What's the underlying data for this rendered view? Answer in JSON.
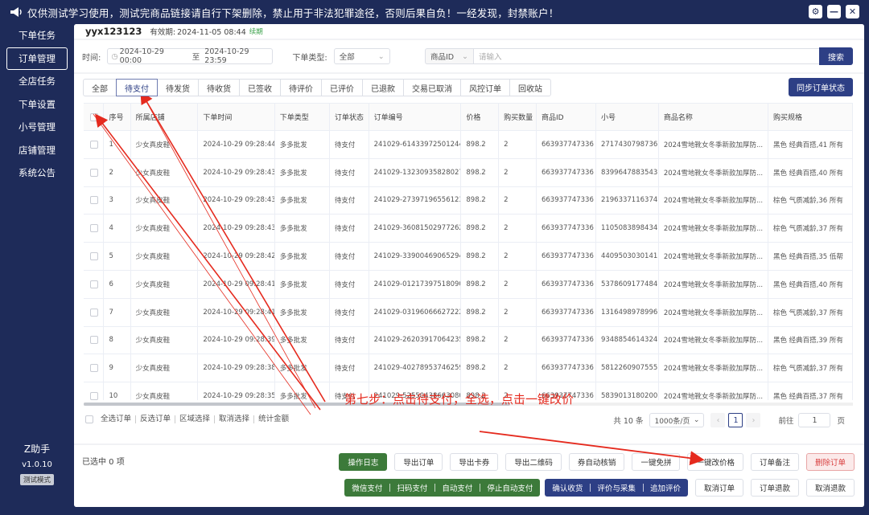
{
  "titlebar": {
    "notice": "仅供测试学习使用，测试完商品链接请自行下架删除，禁止用于非法犯罪途径，否则后果自负！一经发现，封禁账户！"
  },
  "sidebar": {
    "items": [
      "下单任务",
      "订单管理",
      "全店任务",
      "下单设置",
      "小号管理",
      "店铺管理",
      "系统公告"
    ],
    "active_index": 1,
    "brand": "Z助手",
    "version": "v1.0.10",
    "mode": "测试模式"
  },
  "user": {
    "name": "yyx123123",
    "validity_label": "有效期:",
    "validity_date": "2024-11-05 08:44",
    "renew": "续期"
  },
  "filters": {
    "time_label": "时间:",
    "date_start": "2024-10-29 00:00",
    "date_sep": "至",
    "date_end": "2024-10-29 23:59",
    "type_label": "下单类型:",
    "type_value": "全部",
    "field_select": "商品ID",
    "search_placeholder": "请输入",
    "search_button": "搜索"
  },
  "tabs": [
    "全部",
    "待支付",
    "待发货",
    "待收货",
    "已签收",
    "待评价",
    "已评价",
    "已退款",
    "交易已取消",
    "风控订单",
    "回收站"
  ],
  "active_tab": 1,
  "sync_button": "同步订单状态",
  "table": {
    "columns": [
      "序号",
      "所属店铺",
      "下单时间",
      "下单类型",
      "订单状态",
      "订单编号",
      "价格",
      "购买数量",
      "商品ID",
      "小号",
      "商品名称",
      "购买规格"
    ],
    "rows": [
      [
        "1",
        "少女真皮鞋",
        "2024-10-29 09:28:44",
        "多多批发",
        "待支付",
        "241029-614339725012448",
        "898.2",
        "2",
        "663937747336",
        "2717430798736",
        "2024雪地靴女冬季新款加厚防...",
        "黑色 经典百搭,41 所有"
      ],
      [
        "2",
        "少女真皮鞋",
        "2024-10-29 09:28:43",
        "多多批发",
        "待支付",
        "241029-132309358280279",
        "898.2",
        "2",
        "663937747336",
        "8399647883543",
        "2024雪地靴女冬季新款加厚防...",
        "黑色 经典百搭,40 所有"
      ],
      [
        "3",
        "少女真皮鞋",
        "2024-10-29 09:28:43",
        "多多批发",
        "待支付",
        "241029-273971965561238",
        "898.2",
        "2",
        "663937747336",
        "2196337116374",
        "2024雪地靴女冬季新款加厚防...",
        "棕色 气质减龄,36 所有"
      ],
      [
        "4",
        "少女真皮鞋",
        "2024-10-29 09:28:43",
        "多多批发",
        "待支付",
        "241029-360815029772626",
        "898.2",
        "2",
        "663937747336",
        "1105083898434",
        "2024雪地靴女冬季新款加厚防...",
        "棕色 气质减龄,37 所有"
      ],
      [
        "5",
        "少女真皮鞋",
        "2024-10-29 09:28:42",
        "多多批发",
        "待支付",
        "241029-339004690652941",
        "898.2",
        "2",
        "663937747336",
        "4409503030141",
        "2024雪地靴女冬季新款加厚防...",
        "黑色 经典百搭,35 低帮"
      ],
      [
        "6",
        "少女真皮鞋",
        "2024-10-29 09:28:41",
        "多多批发",
        "待支付",
        "241029-012173975180908",
        "898.2",
        "2",
        "663937747336",
        "5378609177484",
        "2024雪地靴女冬季新款加厚防...",
        "黑色 经典百搭,40 所有"
      ],
      [
        "7",
        "少女真皮鞋",
        "2024-10-29 09:28:41",
        "多多批发",
        "待支付",
        "241029-031960666272228",
        "898.2",
        "2",
        "663937747336",
        "1316498978996",
        "2024雪地靴女冬季新款加厚防...",
        "棕色 气质减龄,37 所有"
      ],
      [
        "8",
        "少女真皮鞋",
        "2024-10-29 09:28:39",
        "多多批发",
        "待支付",
        "241029-262039170642356",
        "898.2",
        "2",
        "663937747336",
        "9348854614324",
        "2024雪地靴女冬季新款加厚防...",
        "黑色 经典百搭,39 所有"
      ],
      [
        "9",
        "少女真皮鞋",
        "2024-10-29 09:28:38",
        "多多批发",
        "待支付",
        "241029-402789537462595",
        "898.2",
        "2",
        "663937747336",
        "5812260907555",
        "2024雪地靴女冬季新款加厚防...",
        "棕色 气质减龄,37 所有"
      ],
      [
        "10",
        "少女真皮鞋",
        "2024-10-29 09:28:35",
        "多多批发",
        "待支付",
        "241029-525504386630808",
        "898.2",
        "2",
        "663937747336",
        "5839013180200",
        "2024雪地靴女冬季新款加厚防...",
        "黑色 经典百搭,37 所有"
      ]
    ]
  },
  "table_footer": {
    "links": [
      "全选订单",
      "反选订单",
      "区域选择",
      "取消选择",
      "统计金额"
    ],
    "total": "共 10 条",
    "page_size": "1000条/页",
    "current_page": "1",
    "goto_label": "前往",
    "goto_value": "1",
    "page_unit": "页"
  },
  "annotation": "第七步：点击待支付，全选，点击一键改价",
  "bottom": {
    "selected_info": "已选中 0 项",
    "row1": {
      "log": "操作日志",
      "buttons": [
        "导出订单",
        "导出卡券",
        "导出二维码",
        "券自动核销",
        "一键免拼",
        "一键改价格",
        "订单备注"
      ],
      "delete": "删除订单"
    },
    "row2": {
      "pay_group": [
        "微信支付",
        "扫码支付",
        "自动支付",
        "停止自动支付"
      ],
      "receive_group": [
        "确认收货",
        "评价与采集",
        "追加评价"
      ],
      "buttons": [
        "取消订单",
        "订单退款",
        "取消退款"
      ]
    }
  },
  "colors": {
    "navy": "#1e2b59",
    "accent": "#2d3f85",
    "green": "#3c7a3a",
    "annotation_red": "#e52a1e"
  }
}
